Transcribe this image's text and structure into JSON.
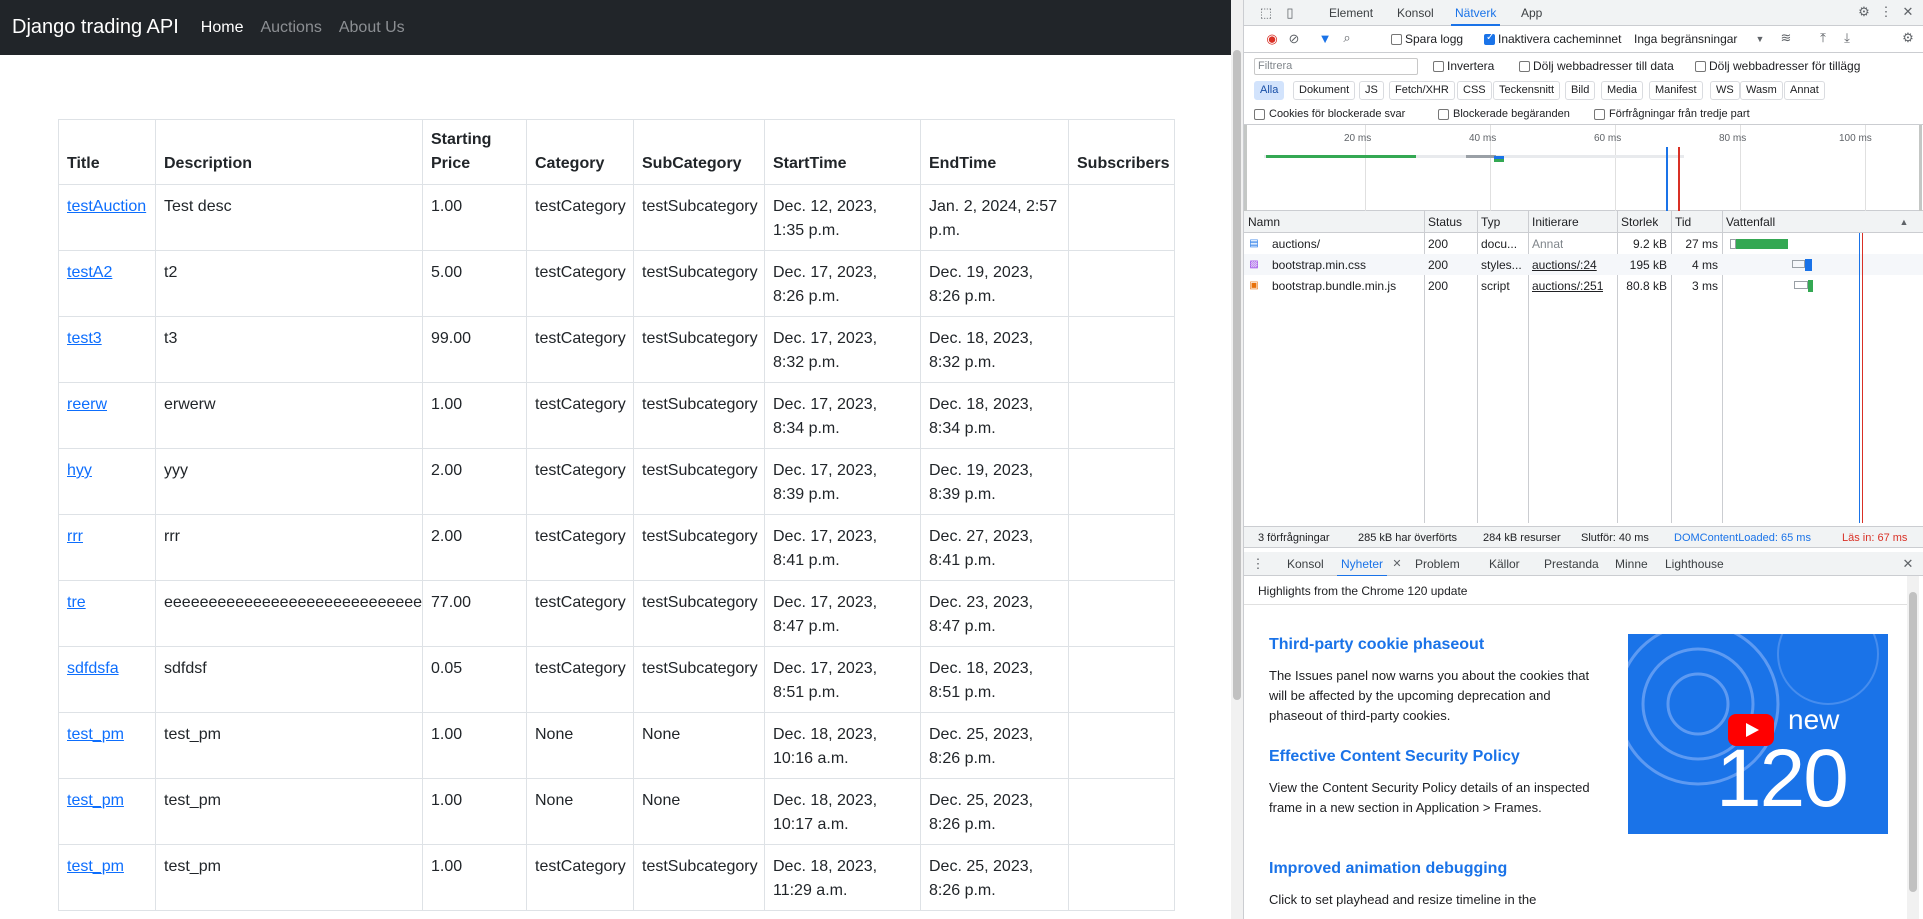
{
  "navbar": {
    "brand": "Django trading API",
    "links": [
      "Home",
      "Auctions",
      "About Us"
    ]
  },
  "auctions": {
    "headers": [
      "Title",
      "Description",
      "Starting Price",
      "Category",
      "SubCategory",
      "StartTime",
      "EndTime",
      "Subscribers"
    ],
    "rows": [
      {
        "title": "testAuction",
        "description": "Test desc",
        "price": "1.00",
        "category": "testCategory",
        "subcategory": "testSubcategory",
        "start": "Dec. 12, 2023, 1:35 p.m.",
        "end": "Jan. 2, 2024, 2:57 p.m.",
        "subscribers": ""
      },
      {
        "title": "testA2",
        "description": "t2",
        "price": "5.00",
        "category": "testCategory",
        "subcategory": "testSubcategory",
        "start": "Dec. 17, 2023, 8:26 p.m.",
        "end": "Dec. 19, 2023, 8:26 p.m.",
        "subscribers": ""
      },
      {
        "title": "test3",
        "description": "t3",
        "price": "99.00",
        "category": "testCategory",
        "subcategory": "testSubcategory",
        "start": "Dec. 17, 2023, 8:32 p.m.",
        "end": "Dec. 18, 2023, 8:32 p.m.",
        "subscribers": ""
      },
      {
        "title": "reerw",
        "description": "erwerw",
        "price": "1.00",
        "category": "testCategory",
        "subcategory": "testSubcategory",
        "start": "Dec. 17, 2023, 8:34 p.m.",
        "end": "Dec. 18, 2023, 8:34 p.m.",
        "subscribers": ""
      },
      {
        "title": "hyy",
        "description": "yyy",
        "price": "2.00",
        "category": "testCategory",
        "subcategory": "testSubcategory",
        "start": "Dec. 17, 2023, 8:39 p.m.",
        "end": "Dec. 19, 2023, 8:39 p.m.",
        "subscribers": ""
      },
      {
        "title": "rrr",
        "description": "rrr",
        "price": "2.00",
        "category": "testCategory",
        "subcategory": "testSubcategory",
        "start": "Dec. 17, 2023, 8:41 p.m.",
        "end": "Dec. 27, 2023, 8:41 p.m.",
        "subscribers": ""
      },
      {
        "title": "tre",
        "description": "eeeeeeeeeeeeeeeeeeeeeeeeeeeeee",
        "price": "77.00",
        "category": "testCategory",
        "subcategory": "testSubcategory",
        "start": "Dec. 17, 2023, 8:47 p.m.",
        "end": "Dec. 23, 2023, 8:47 p.m.",
        "subscribers": ""
      },
      {
        "title": "sdfdsfa",
        "description": "sdfdsf",
        "price": "0.05",
        "category": "testCategory",
        "subcategory": "testSubcategory",
        "start": "Dec. 17, 2023, 8:51 p.m.",
        "end": "Dec. 18, 2023, 8:51 p.m.",
        "subscribers": ""
      },
      {
        "title": "test_pm",
        "description": "test_pm",
        "price": "1.00",
        "category": "None",
        "subcategory": "None",
        "start": "Dec. 18, 2023, 10:16 a.m.",
        "end": "Dec. 25, 2023, 8:26 p.m.",
        "subscribers": ""
      },
      {
        "title": "test_pm",
        "description": "test_pm",
        "price": "1.00",
        "category": "None",
        "subcategory": "None",
        "start": "Dec. 18, 2023, 10:17 a.m.",
        "end": "Dec. 25, 2023, 8:26 p.m.",
        "subscribers": ""
      },
      {
        "title": "test_pm",
        "description": "test_pm",
        "price": "1.00",
        "category": "testCategory",
        "subcategory": "testSubcategory",
        "start": "Dec. 18, 2023, 11:29 a.m.",
        "end": "Dec. 25, 2023, 8:26 p.m.",
        "subscribers": ""
      }
    ]
  },
  "devtools": {
    "tabs": [
      "Element",
      "Konsol",
      "Nätverk",
      "App"
    ],
    "selected_tab": "Nätverk",
    "toolbar": {
      "preserve_log": "Spara logg",
      "disable_cache": "Inaktivera cacheminnet",
      "throttle": "Inga begränsningar"
    },
    "filter": {
      "placeholder": "Filtrera",
      "invert": "Invertera",
      "hide_data_urls": "Dölj webbadresser till data",
      "hide_extension_urls": "Dölj webbadresser för tillägg"
    },
    "type_chips": [
      "Alla",
      "Dokument",
      "JS",
      "Fetch/XHR",
      "CSS",
      "Teckensnitt",
      "Bild",
      "Media",
      "Manifest",
      "WS",
      "Wasm",
      "Annat"
    ],
    "options": [
      "Cookies för blockerade svar",
      "Blockerade begäranden",
      "Förfrågningar från tredje part"
    ],
    "overview_ticks": [
      "20 ms",
      "40 ms",
      "60 ms",
      "80 ms",
      "100 ms"
    ],
    "columns": [
      "Namn",
      "Status",
      "Typ",
      "Initierare",
      "Storlek",
      "Tid",
      "Vattenfall"
    ],
    "requests": [
      {
        "name": "auctions/",
        "status": "200",
        "type": "docu...",
        "initiator": "Annat",
        "size": "9.2 kB",
        "time": "27 ms"
      },
      {
        "name": "bootstrap.min.css",
        "status": "200",
        "type": "styles...",
        "initiator": "auctions/:24",
        "size": "195 kB",
        "time": "4 ms"
      },
      {
        "name": "bootstrap.bundle.min.js",
        "status": "200",
        "type": "script",
        "initiator": "auctions/:251",
        "size": "80.8 kB",
        "time": "3 ms"
      }
    ],
    "summary": {
      "requests": "3 förfrågningar",
      "transferred": "285 kB har överförts",
      "resources": "284 kB resurser",
      "finish": "Slutför: 40 ms",
      "dcl": "DOMContentLoaded: 65 ms",
      "load": "Läs in: 67 ms"
    },
    "drawer_tabs": [
      "Konsol",
      "Nyheter",
      "Problem",
      "Källor",
      "Prestanda",
      "Minne",
      "Lighthouse"
    ],
    "drawer_selected": "Nyheter",
    "news": {
      "highlight": "Highlights from the Chrome 120 update",
      "items": [
        {
          "title": "Third-party cookie phaseout",
          "body": "The Issues panel now warns you about the cookies that will be affected by the upcoming deprecation and phaseout of third-party cookies."
        },
        {
          "title": "Effective Content Security Policy",
          "body": "View the Content Security Policy details of an inspected frame in a new section in Application > Frames."
        },
        {
          "title": "Improved animation debugging",
          "body": "Click to set playhead and resize timeline in the"
        }
      ],
      "badge_new": "new",
      "badge_version": "120"
    },
    "colors": {
      "accent": "#1a73e8",
      "navbar": "#212529",
      "link": "#0d6efd",
      "bar_green": "#34a853",
      "dcl_line": "#1a73e8",
      "load_line": "#d93025"
    }
  }
}
